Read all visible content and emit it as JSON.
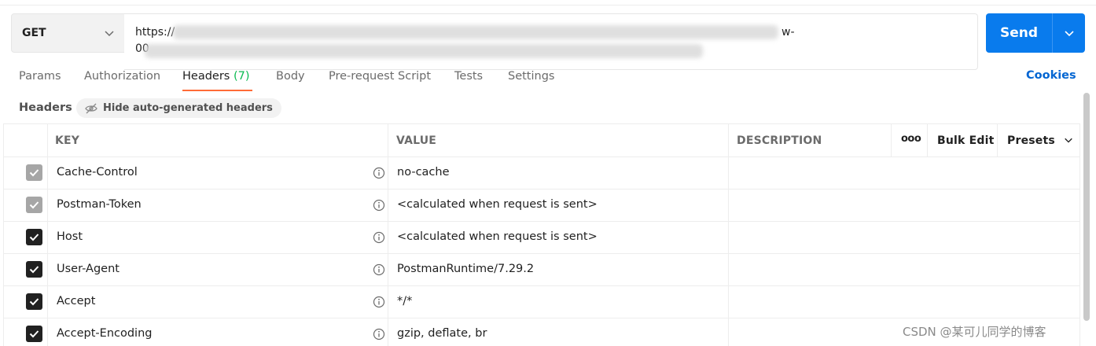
{
  "request": {
    "method": "GET",
    "url_line1": "https://",
    "url_line1_tail": "w-",
    "url_line2": "00",
    "send_label": "Send"
  },
  "tabs": [
    {
      "label": "Params"
    },
    {
      "label": "Authorization"
    },
    {
      "label": "Headers",
      "count": "(7)",
      "active": true
    },
    {
      "label": "Body"
    },
    {
      "label": "Pre-request Script"
    },
    {
      "label": "Tests"
    },
    {
      "label": "Settings"
    }
  ],
  "cookies_label": "Cookies",
  "headers_bar": {
    "title": "Headers",
    "hide_label": "Hide auto-generated headers"
  },
  "table": {
    "columns": {
      "key": "KEY",
      "value": "VALUE",
      "description": "DESCRIPTION",
      "more": "ooo",
      "bulk_edit": "Bulk Edit",
      "presets": "Presets"
    },
    "rows": [
      {
        "key": "Cache-Control",
        "value": "no-cache",
        "checked": true,
        "auto": true
      },
      {
        "key": "Postman-Token",
        "value": "<calculated when request is sent>",
        "checked": true,
        "auto": true
      },
      {
        "key": "Host",
        "value": "<calculated when request is sent>",
        "checked": true,
        "auto": false
      },
      {
        "key": "User-Agent",
        "value": "PostmanRuntime/7.29.2",
        "checked": true,
        "auto": false
      },
      {
        "key": "Accept",
        "value": "*/*",
        "checked": true,
        "auto": false
      },
      {
        "key": "Accept-Encoding",
        "value": "gzip, deflate, br",
        "checked": true,
        "auto": false
      }
    ]
  },
  "watermark": "CSDN @某可儿同学的博客",
  "colors": {
    "send": "#097bed",
    "tab_underline": "#ff6c37",
    "count_green": "#0cbb52",
    "cookies_link": "#0265d2"
  }
}
